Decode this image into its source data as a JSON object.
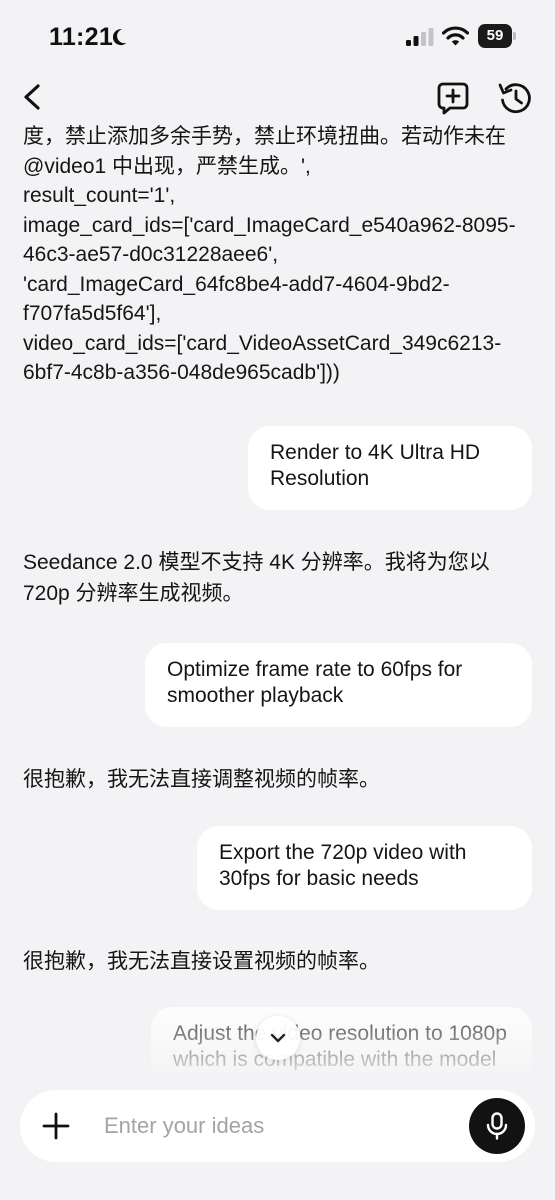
{
  "status_bar": {
    "time": "11:21",
    "battery": "59",
    "icons": [
      "moon-icon",
      "signal-icon",
      "wifi-icon",
      "battery-icon"
    ]
  },
  "nav": {
    "icons": [
      "back-icon",
      "new-chat-icon",
      "history-icon"
    ]
  },
  "messages": [
    {
      "role": "assistant",
      "text": "度，禁止添加多余手势，禁止环境扭曲。若动作未在 @video1 中出现，严禁生成。',\nresult_count='1',\nimage_card_ids=['card_ImageCard_e540a962-8095-46c3-ae57-d0c31228aee6',\n'card_ImageCard_64fc8be4-add7-4604-9bd2-f707fa5d5f64'],\nvideo_card_ids=['card_VideoAssetCard_349c6213-6bf7-4c8b-a356-048de965cadb']))"
    },
    {
      "role": "user",
      "text": "Render to 4K Ultra HD Resolution"
    },
    {
      "role": "assistant",
      "text": "Seedance 2.0 模型不支持 4K 分辨率。我将为您以 720p 分辨率生成视频。"
    },
    {
      "role": "user",
      "text": "Optimize frame rate to 60fps for smoother playback"
    },
    {
      "role": "assistant",
      "text": "很抱歉，我无法直接调整视频的帧率。"
    },
    {
      "role": "user",
      "text": "Export the 720p video with 30fps for basic needs"
    },
    {
      "role": "assistant",
      "text": "很抱歉，我无法直接设置视频的帧率。"
    },
    {
      "role": "user",
      "text": "Adjust the video resolution to 1080p which is compatible with the model"
    }
  ],
  "composer": {
    "placeholder": "Enter your ideas",
    "icons": [
      "plus-icon",
      "microphone-icon"
    ]
  },
  "scroll_button_icon": "chevron-down-icon",
  "colors": {
    "background": "#f3f3f5",
    "bubble": "#ffffff",
    "mic_button": "#121212",
    "placeholder": "#a3a3a8"
  }
}
